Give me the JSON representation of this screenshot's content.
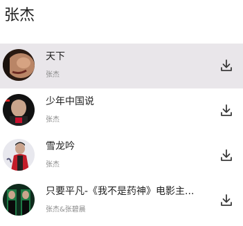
{
  "page": {
    "title": "张杰"
  },
  "songs": [
    {
      "title": "天下",
      "artist": "张杰",
      "selected": true,
      "cover_icon": "album-cover-face"
    },
    {
      "title": "少年中国说",
      "artist": "张杰",
      "selected": false,
      "cover_icon": "album-cover-portrait"
    },
    {
      "title": "雪龙吟",
      "artist": "张杰",
      "selected": false,
      "cover_icon": "album-cover-red-jacket"
    },
    {
      "title": "只要平凡-《我不是药神》电影主...",
      "artist": "张杰&张碧晨",
      "selected": false,
      "cover_icon": "album-cover-green"
    }
  ],
  "colors": {
    "selected_row_bg": "#e9e6ea",
    "subtitle_gray": "#8a8a8a",
    "icon_dark": "#3a3a3a"
  }
}
